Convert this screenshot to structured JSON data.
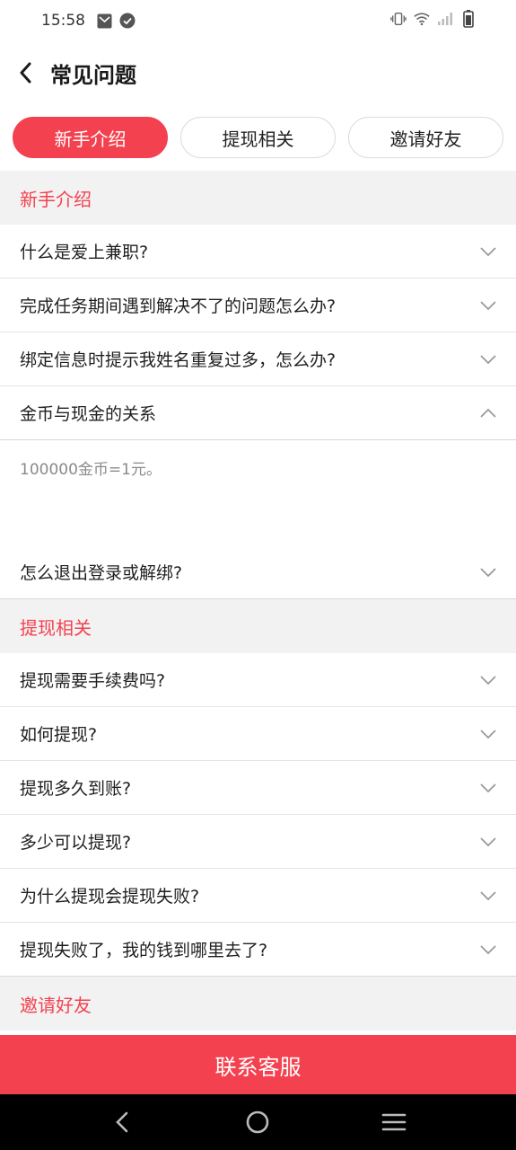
{
  "status_bar": {
    "time": "15:58",
    "left_icons": [
      "mail-icon",
      "check-circle-icon"
    ],
    "right_icons": [
      "vibrate-icon",
      "wifi-icon",
      "signal-icon",
      "battery-icon"
    ]
  },
  "header": {
    "title": "常见问题",
    "back_icon": "chevron-left-icon"
  },
  "tabs": [
    {
      "label": "新手介绍",
      "active": true
    },
    {
      "label": "提现相关",
      "active": false
    },
    {
      "label": "邀请好友",
      "active": false
    }
  ],
  "sections": [
    {
      "title": "新手介绍",
      "items": [
        {
          "question": "什么是爱上兼职?",
          "expanded": false
        },
        {
          "question": "完成任务期间遇到解决不了的问题怎么办?",
          "expanded": false
        },
        {
          "question": "绑定信息时提示我姓名重复过多，怎么办?",
          "expanded": false
        },
        {
          "question": "金币与现金的关系",
          "expanded": true,
          "answer": "100000金币=1元。"
        },
        {
          "question": "怎么退出登录或解绑?",
          "expanded": false
        }
      ]
    },
    {
      "title": "提现相关",
      "items": [
        {
          "question": "提现需要手续费吗?",
          "expanded": false
        },
        {
          "question": "如何提现?",
          "expanded": false
        },
        {
          "question": "提现多久到账?",
          "expanded": false
        },
        {
          "question": "多少可以提现?",
          "expanded": false
        },
        {
          "question": "为什么提现会提现失败?",
          "expanded": false
        },
        {
          "question": "提现失败了，我的钱到哪里去了?",
          "expanded": false
        }
      ]
    },
    {
      "title": "邀请好友",
      "items": []
    }
  ],
  "contact_button": {
    "label": "联系客服"
  },
  "nav_bar": {
    "icons": [
      "back-triangle-icon",
      "home-circle-icon",
      "menu-lines-icon"
    ]
  },
  "colors": {
    "accent": "#f4414f",
    "section_bg": "#f2f2f2",
    "answer_text": "#8a8a8a"
  }
}
